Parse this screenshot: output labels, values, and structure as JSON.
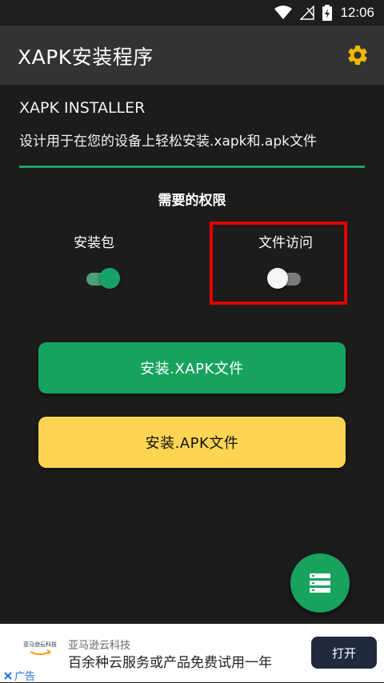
{
  "status_bar": {
    "time": "12:06"
  },
  "app_bar": {
    "title": "XAPK安装程序",
    "settings_icon": "gear-icon",
    "accent": "#f2b705"
  },
  "main": {
    "heading": "XAPK INSTALLER",
    "description": "设计用于在您的设备上轻松安装.xapk和.apk文件",
    "permissions_title": "需要的权限",
    "permissions": [
      {
        "label": "安装包",
        "enabled": true
      },
      {
        "label": "文件访问",
        "enabled": false
      }
    ],
    "install_xapk_label": "安装.XAPK文件",
    "install_apk_label": "安装.APK文件",
    "fab_icon": "list-icon",
    "colors": {
      "green": "#17a35e",
      "yellow": "#fdd552",
      "highlight": "#e00000"
    }
  },
  "ad": {
    "logo_text": "亚马逊云科技",
    "brand": "亚马逊云科技",
    "text": "百余种云服务或产品免费试用一年",
    "open_label": "打开",
    "ad_label": "广告"
  }
}
